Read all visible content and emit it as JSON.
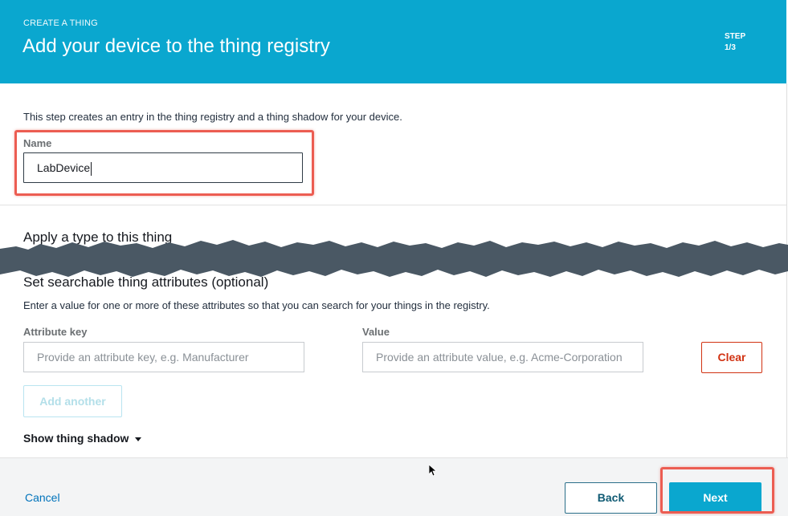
{
  "header": {
    "eyebrow": "CREATE A THING",
    "title": "Add your device to the thing registry",
    "step_label": "STEP",
    "step_value": "1/3"
  },
  "intro": {
    "description": "This step creates an entry in the thing registry and a thing shadow for your device."
  },
  "name_field": {
    "label": "Name",
    "value": "LabDevice"
  },
  "sections": {
    "type_title": "Apply a type to this thing",
    "attributes_title": "Set searchable thing attributes (optional)",
    "attributes_description": "Enter a value for one or more of these attributes so that you can search for your things in the registry."
  },
  "attributes": {
    "key_label": "Attribute key",
    "key_placeholder": "Provide an attribute key, e.g. Manufacturer",
    "value_label": "Value",
    "value_placeholder": "Provide an attribute value, e.g. Acme-Corporation",
    "clear_label": "Clear",
    "add_label": "Add another"
  },
  "shadow": {
    "toggle_label": "Show thing shadow"
  },
  "footer": {
    "cancel_label": "Cancel",
    "back_label": "Back",
    "next_label": "Next"
  },
  "icons": {
    "dropdown": "caret-down-icon",
    "cursor": "mouse-pointer-icon"
  },
  "colors": {
    "header_bg": "#0aa7cf",
    "primary": "#0aa7cf",
    "danger": "#d13212",
    "link": "#0073bb",
    "highlight": "#ec5d52",
    "tear": "#4a5864"
  }
}
